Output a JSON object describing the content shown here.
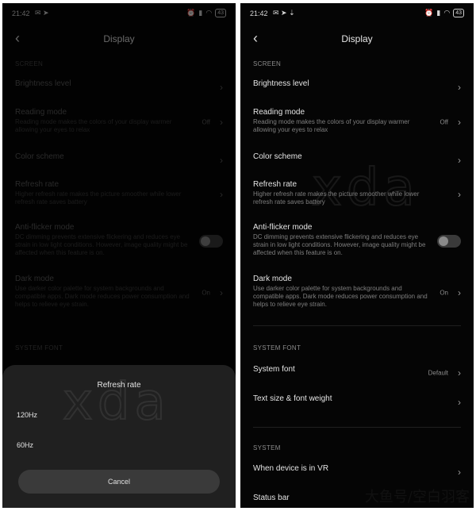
{
  "status": {
    "time": "21:42",
    "battery": "43"
  },
  "title": "Display",
  "sections": {
    "screen": "SCREEN",
    "system_font": "SYSTEM FONT",
    "system": "SYSTEM"
  },
  "rows": {
    "brightness": {
      "label": "Brightness level"
    },
    "reading": {
      "label": "Reading mode",
      "desc": "Reading mode makes the colors of your display warmer allowing your eyes to relax",
      "value": "Off"
    },
    "color": {
      "label": "Color scheme"
    },
    "refresh": {
      "label": "Refresh rate",
      "desc": "Higher refresh rate makes the picture smoother while lower refresh rate saves battery"
    },
    "antiflicker": {
      "label": "Anti-flicker mode",
      "desc": "DC dimming prevents extensive flickering and reduces eye strain in low light conditions. However, image quality might be affected when this feature is on."
    },
    "dark": {
      "label": "Dark mode",
      "desc": "Use darker color palette for system backgrounds and compatible apps. Dark mode reduces power consumption and helps to relieve eye strain.",
      "value": "On"
    },
    "system_font": {
      "label": "System font",
      "value": "Default"
    },
    "text_size": {
      "label": "Text size & font weight"
    },
    "vr": {
      "label": "When device is in VR"
    },
    "status_bar": {
      "label": "Status bar"
    }
  },
  "sheet": {
    "title": "Refresh rate",
    "options": [
      "120Hz",
      "60Hz"
    ],
    "cancel": "Cancel"
  },
  "watermark": {
    "logo": "xda",
    "caption": "大鱼号/空白羽客"
  }
}
